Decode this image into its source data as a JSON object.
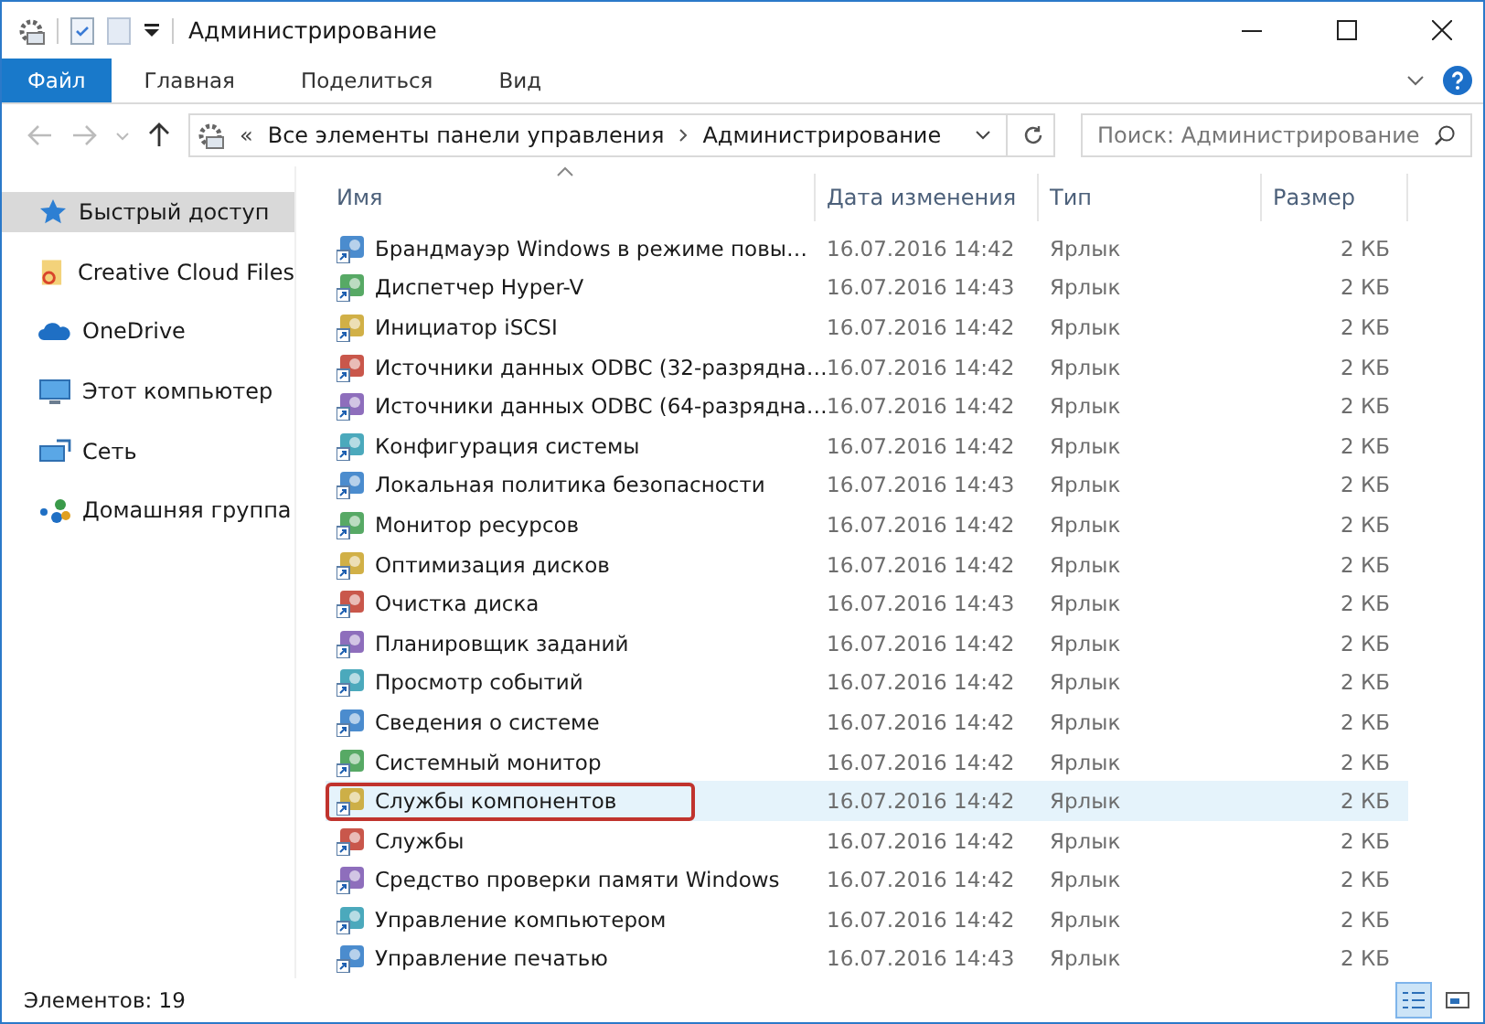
{
  "window": {
    "title": "Администрирование"
  },
  "ribbon_tabs": [
    {
      "label": "Файл",
      "selected": true
    },
    {
      "label": "Главная",
      "selected": false
    },
    {
      "label": "Поделиться",
      "selected": false
    },
    {
      "label": "Вид",
      "selected": false
    }
  ],
  "address_bar": {
    "overflow": "«",
    "path": [
      "Все элементы панели управления",
      "Администрирование"
    ]
  },
  "search": {
    "placeholder": "Поиск: Администрирование"
  },
  "sidebar": {
    "items": [
      {
        "label": "Быстрый доступ",
        "selected": true,
        "kind": "star"
      },
      {
        "label": "Creative Cloud Files",
        "selected": false,
        "kind": "cloudfolder"
      },
      {
        "label": "OneDrive",
        "selected": false,
        "kind": "onedrive"
      },
      {
        "label": "Этот компьютер",
        "selected": false,
        "kind": "pc"
      },
      {
        "label": "Сеть",
        "selected": false,
        "kind": "network"
      },
      {
        "label": "Домашняя группа",
        "selected": false,
        "kind": "homegroup"
      }
    ]
  },
  "table": {
    "columns": [
      "Имя",
      "Дата изменения",
      "Тип",
      "Размер"
    ],
    "rows": [
      {
        "name": "Брандмауэр Windows в режиме повы…",
        "date": "16.07.2016 14:42",
        "type": "Ярлык",
        "size": "2 КБ",
        "selected": false,
        "outlined": false
      },
      {
        "name": "Диспетчер Hyper-V",
        "date": "16.07.2016 14:43",
        "type": "Ярлык",
        "size": "2 КБ",
        "selected": false,
        "outlined": false
      },
      {
        "name": "Инициатор iSCSI",
        "date": "16.07.2016 14:42",
        "type": "Ярлык",
        "size": "2 КБ",
        "selected": false,
        "outlined": false
      },
      {
        "name": "Источники данных ODBC (32-разрядна…",
        "date": "16.07.2016 14:42",
        "type": "Ярлык",
        "size": "2 КБ",
        "selected": false,
        "outlined": false
      },
      {
        "name": "Источники данных ODBC (64-разрядна…",
        "date": "16.07.2016 14:42",
        "type": "Ярлык",
        "size": "2 КБ",
        "selected": false,
        "outlined": false
      },
      {
        "name": "Конфигурация системы",
        "date": "16.07.2016 14:42",
        "type": "Ярлык",
        "size": "2 КБ",
        "selected": false,
        "outlined": false
      },
      {
        "name": "Локальная политика безопасности",
        "date": "16.07.2016 14:43",
        "type": "Ярлык",
        "size": "2 КБ",
        "selected": false,
        "outlined": false
      },
      {
        "name": "Монитор ресурсов",
        "date": "16.07.2016 14:42",
        "type": "Ярлык",
        "size": "2 КБ",
        "selected": false,
        "outlined": false
      },
      {
        "name": "Оптимизация дисков",
        "date": "16.07.2016 14:42",
        "type": "Ярлык",
        "size": "2 КБ",
        "selected": false,
        "outlined": false
      },
      {
        "name": "Очистка диска",
        "date": "16.07.2016 14:43",
        "type": "Ярлык",
        "size": "2 КБ",
        "selected": false,
        "outlined": false
      },
      {
        "name": "Планировщик заданий",
        "date": "16.07.2016 14:42",
        "type": "Ярлык",
        "size": "2 КБ",
        "selected": false,
        "outlined": false
      },
      {
        "name": "Просмотр событий",
        "date": "16.07.2016 14:42",
        "type": "Ярлык",
        "size": "2 КБ",
        "selected": false,
        "outlined": false
      },
      {
        "name": "Сведения о системе",
        "date": "16.07.2016 14:42",
        "type": "Ярлык",
        "size": "2 КБ",
        "selected": false,
        "outlined": false
      },
      {
        "name": "Системный монитор",
        "date": "16.07.2016 14:42",
        "type": "Ярлык",
        "size": "2 КБ",
        "selected": false,
        "outlined": false
      },
      {
        "name": "Службы компонентов",
        "date": "16.07.2016 14:42",
        "type": "Ярлык",
        "size": "2 КБ",
        "selected": true,
        "outlined": true
      },
      {
        "name": "Службы",
        "date": "16.07.2016 14:42",
        "type": "Ярлык",
        "size": "2 КБ",
        "selected": false,
        "outlined": false
      },
      {
        "name": "Средство проверки памяти Windows",
        "date": "16.07.2016 14:42",
        "type": "Ярлык",
        "size": "2 КБ",
        "selected": false,
        "outlined": false
      },
      {
        "name": "Управление компьютером",
        "date": "16.07.2016 14:42",
        "type": "Ярлык",
        "size": "2 КБ",
        "selected": false,
        "outlined": false
      },
      {
        "name": "Управление печатью",
        "date": "16.07.2016 14:43",
        "type": "Ярлык",
        "size": "2 КБ",
        "selected": false,
        "outlined": false
      }
    ]
  },
  "status_bar": {
    "text": "Элементов: 19",
    "view_buttons": [
      {
        "kind": "details",
        "selected": true
      },
      {
        "kind": "large",
        "selected": false
      }
    ]
  }
}
